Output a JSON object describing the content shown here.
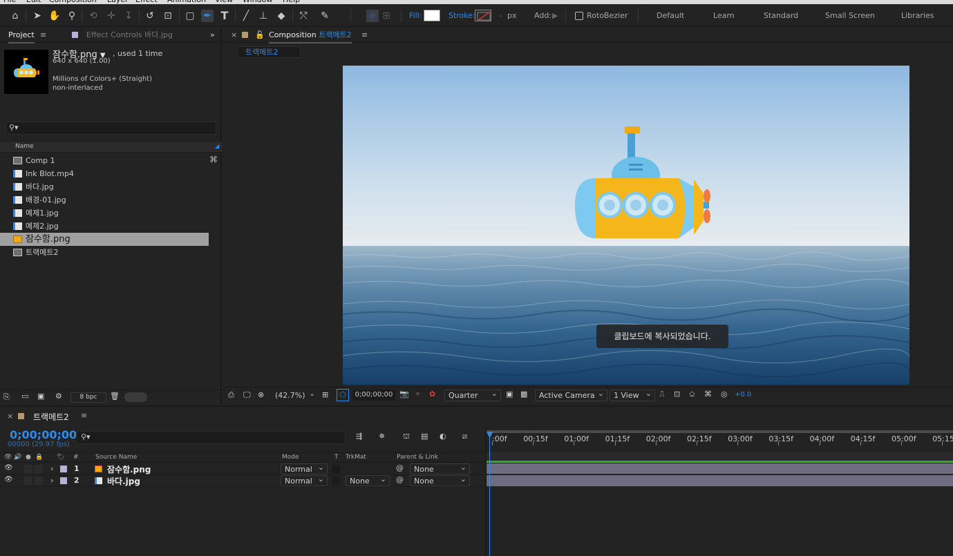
{
  "menu": [
    "File",
    "Edit",
    "Composition",
    "Layer",
    "Effect",
    "Animation",
    "View",
    "Window",
    "Help"
  ],
  "toolbar": {
    "fill_label": "Fill:",
    "stroke_label": "Stroke:",
    "stroke_value": "-",
    "stroke_unit": "px",
    "add_label": "Add:",
    "rotobezier": "RotoBezier",
    "workspaces": [
      "Default",
      "Learn",
      "Standard",
      "Small Screen",
      "Libraries"
    ]
  },
  "project": {
    "tab_project": "Project",
    "tab_effect": "Effect Controls 바다.jpg",
    "asset_name": "잠수함.png",
    "asset_used": ", used 1 time",
    "asset_dims": "640 x 640 (1.00)",
    "asset_colors": "Millions of Colors+ (Straight)",
    "asset_interlace": "non-interlaced",
    "col_name": "Name",
    "items": [
      {
        "label": "Comp 1",
        "type": "comp"
      },
      {
        "label": "Ink Blot.mp4",
        "type": "video"
      },
      {
        "label": "바다.jpg",
        "type": "image"
      },
      {
        "label": "배경-01.jpg",
        "type": "image"
      },
      {
        "label": "예제1.jpg",
        "type": "image"
      },
      {
        "label": "예제2.jpg",
        "type": "image"
      },
      {
        "label": "잠수함.png",
        "type": "png",
        "selected": true
      },
      {
        "label": "트랙메트2",
        "type": "comp"
      }
    ],
    "bpc": "8 bpc"
  },
  "composition": {
    "tab_label": "Composition",
    "comp_name": "트랙메트2",
    "breadcrumb": "트랙메트2",
    "toast": "클립보드에 복사되었습니다.",
    "footer": {
      "zoom": "(42.7%)",
      "timecode": "0;00;00;00",
      "resolution": "Quarter",
      "camera": "Active Camera",
      "view": "1 View",
      "exposure": "+0.0"
    }
  },
  "timeline": {
    "comp_name": "트랙메트2",
    "timecode": "0;00;00;00",
    "frames": "00000 (29.97 fps)",
    "columns": {
      "num": "#",
      "source": "Source Name",
      "mode": "Mode",
      "t": "T",
      "trkmat": "TrkMat",
      "parent": "Parent & Link"
    },
    "layers": [
      {
        "num": "1",
        "name": "잠수함.png",
        "mode": "Normal",
        "trkmat": "",
        "parent": "None",
        "color": "#b7b0d8",
        "type": "png"
      },
      {
        "num": "2",
        "name": "바다.jpg",
        "mode": "Normal",
        "trkmat": "None",
        "parent": "None",
        "color": "#b7b0d8",
        "type": "image"
      }
    ],
    "ruler": [
      ":00f",
      "00:15f",
      "01:00f",
      "01:15f",
      "02:00f",
      "02:15f",
      "03:00f",
      "03:15f",
      "04:00f",
      "04:15f",
      "05:00f",
      "05:15f"
    ]
  },
  "colors": {
    "accent": "#2d8ceb",
    "bg": "#232323",
    "green": "#2fae2f",
    "layer_bar": "#6f6b80"
  }
}
